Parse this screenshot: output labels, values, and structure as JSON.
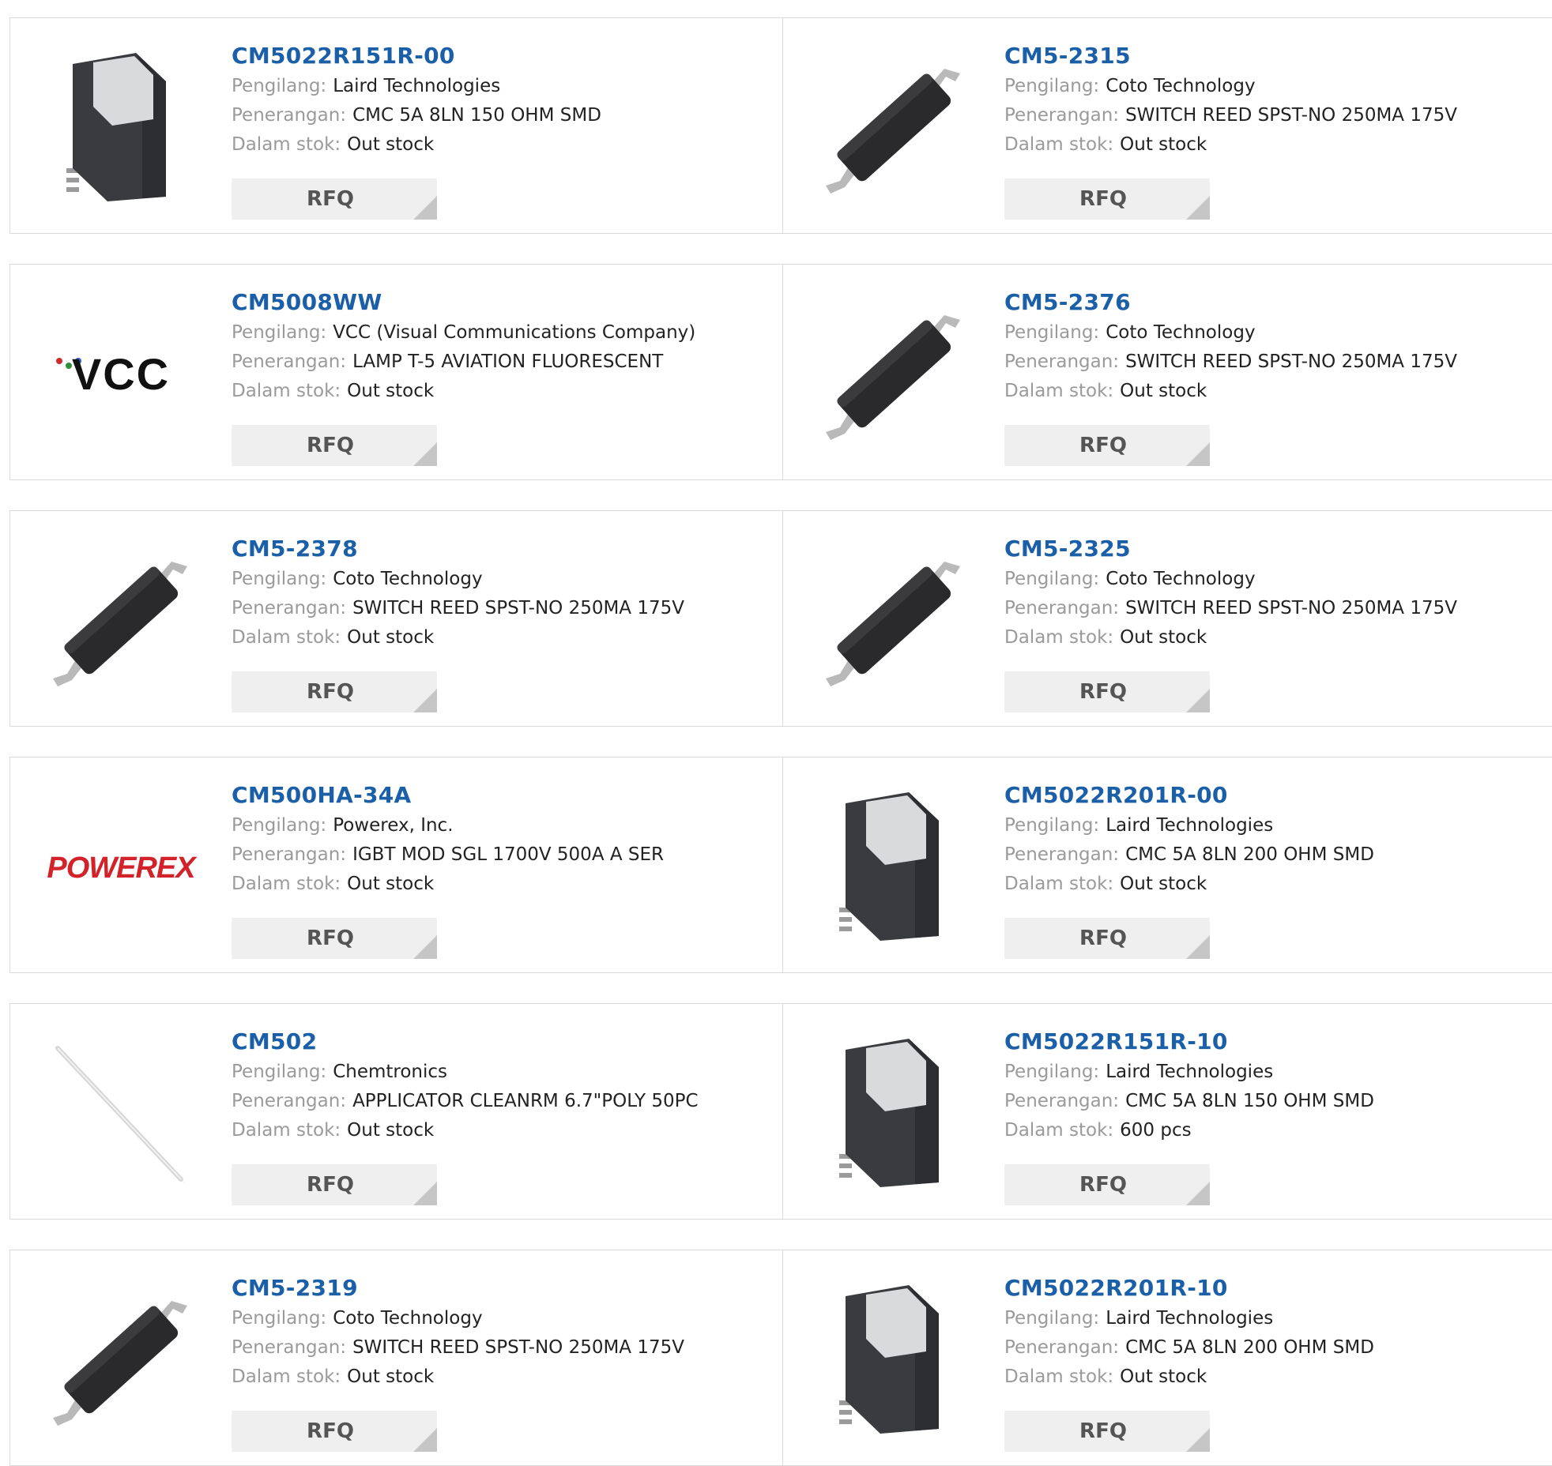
{
  "labels": {
    "manufacturer": "Pengilang:",
    "description": "Penerangan:",
    "stock": "Dalam stok:",
    "rfq": "RFQ"
  },
  "rows": [
    [
      {
        "part": "CM5022R151R-00",
        "manufacturer": "Laird Technologies",
        "description": "CMC 5A 8LN 150 OHM SMD",
        "stock": "Out stock",
        "image": "cmc-inductor"
      },
      {
        "part": "CM5-2315",
        "manufacturer": "Coto Technology",
        "description": "SWITCH REED SPST-NO 250MA 175V",
        "stock": "Out stock",
        "image": "reed-switch"
      }
    ],
    [
      {
        "part": "CM5008WW",
        "manufacturer": "VCC (Visual Communications Company)",
        "description": "LAMP T-5 AVIATION FLUORESCENT",
        "stock": "Out stock",
        "image": "vcc-logo",
        "logo_text": "VCC"
      },
      {
        "part": "CM5-2376",
        "manufacturer": "Coto Technology",
        "description": "SWITCH REED SPST-NO 250MA 175V",
        "stock": "Out stock",
        "image": "reed-switch"
      }
    ],
    [
      {
        "part": "CM5-2378",
        "manufacturer": "Coto Technology",
        "description": "SWITCH REED SPST-NO 250MA 175V",
        "stock": "Out stock",
        "image": "reed-switch"
      },
      {
        "part": "CM5-2325",
        "manufacturer": "Coto Technology",
        "description": "SWITCH REED SPST-NO 250MA 175V",
        "stock": "Out stock",
        "image": "reed-switch"
      }
    ],
    [
      {
        "part": "CM500HA-34A",
        "manufacturer": "Powerex, Inc.",
        "description": "IGBT MOD SGL 1700V 500A A SER",
        "stock": "Out stock",
        "image": "powerex-logo",
        "logo_text": "POWEREX"
      },
      {
        "part": "CM5022R201R-00",
        "manufacturer": "Laird Technologies",
        "description": "CMC 5A 8LN 200 OHM SMD",
        "stock": "Out stock",
        "image": "cmc-inductor"
      }
    ],
    [
      {
        "part": "CM502",
        "manufacturer": "Chemtronics",
        "description": "APPLICATOR CLEANRM 6.7\"POLY 50PC",
        "stock": "Out stock",
        "image": "applicator-swab"
      },
      {
        "part": "CM5022R151R-10",
        "manufacturer": "Laird Technologies",
        "description": "CMC 5A 8LN 150 OHM SMD",
        "stock": "600 pcs",
        "image": "cmc-inductor"
      }
    ],
    [
      {
        "part": "CM5-2319",
        "manufacturer": "Coto Technology",
        "description": "SWITCH REED SPST-NO 250MA 175V",
        "stock": "Out stock",
        "image": "reed-switch"
      },
      {
        "part": "CM5022R201R-10",
        "manufacturer": "Laird Technologies",
        "description": "CMC 5A 8LN 200 OHM SMD",
        "stock": "Out stock",
        "image": "cmc-inductor"
      }
    ]
  ]
}
